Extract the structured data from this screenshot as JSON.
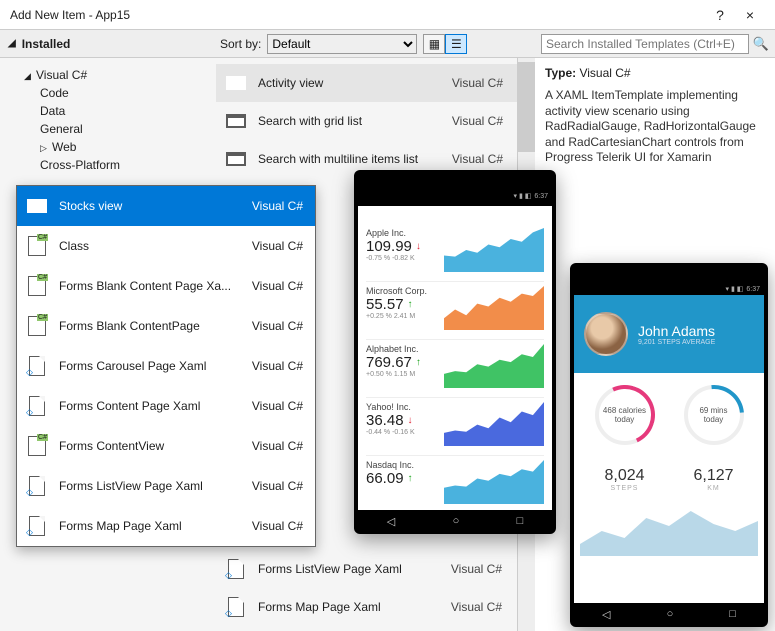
{
  "window": {
    "title": "Add New Item - App15",
    "help": "?",
    "close": "×"
  },
  "header": {
    "installed": "Installed",
    "sort_label": "Sort by:",
    "sort_value": "Default",
    "search_placeholder": "Search Installed Templates (Ctrl+E)"
  },
  "tree": {
    "root": "Visual C#",
    "items": [
      "Code",
      "Data",
      "General",
      "Web",
      "Cross-Platform"
    ]
  },
  "templates_bg": [
    {
      "label": "Activity view",
      "lang": "Visual C#",
      "sel": true,
      "icon": "rect"
    },
    {
      "label": "Search with grid list",
      "lang": "Visual C#",
      "icon": "rect"
    },
    {
      "label": "Search with multiline items list",
      "lang": "Visual C#",
      "icon": "rect"
    }
  ],
  "templates_bg_bottom": [
    {
      "label": "Forms ListView Page Xaml",
      "lang": "Visual C#",
      "icon": "page"
    },
    {
      "label": "Forms Map Page Xaml",
      "lang": "Visual C#",
      "icon": "page"
    }
  ],
  "popup": [
    {
      "label": "Stocks view",
      "lang": "Visual C#",
      "sel": true,
      "icon": "rect"
    },
    {
      "label": "Class",
      "lang": "Visual C#",
      "icon": "cs"
    },
    {
      "label": "Forms Blank Content Page Xa...",
      "lang": "Visual C#",
      "icon": "cs"
    },
    {
      "label": "Forms Blank ContentPage",
      "lang": "Visual C#",
      "icon": "cs"
    },
    {
      "label": "Forms Carousel Page Xaml",
      "lang": "Visual C#",
      "icon": "page"
    },
    {
      "label": "Forms Content Page Xaml",
      "lang": "Visual C#",
      "icon": "page"
    },
    {
      "label": "Forms ContentView",
      "lang": "Visual C#",
      "icon": "cs"
    },
    {
      "label": "Forms ListView Page Xaml",
      "lang": "Visual C#",
      "icon": "page"
    },
    {
      "label": "Forms Map Page Xaml",
      "lang": "Visual C#",
      "icon": "page"
    }
  ],
  "right": {
    "type_label": "Type:",
    "type_value": "Visual C#",
    "description": "A XAML ItemTemplate implementing activity view scenario using RadRadialGauge, RadHorizontalGauge and RadCartesianChart controls from Progress Telerik UI for Xamarin"
  },
  "phone1": {
    "time": "6:37",
    "stocks": [
      {
        "name": "Apple Inc.",
        "price": "109.99",
        "dir": "dn",
        "sub": "-0.75 %    -0.82 K",
        "color": "#2aa5d8"
      },
      {
        "name": "Microsoft Corp.",
        "price": "55.57",
        "dir": "up",
        "sub": "+0.25 %    2.41 M",
        "color": "#f0792a"
      },
      {
        "name": "Alphabet Inc.",
        "price": "769.67",
        "dir": "up",
        "sub": "+0.50 %    1.15 M",
        "color": "#1fb84a"
      },
      {
        "name": "Yahoo! Inc.",
        "price": "36.48",
        "dir": "dn",
        "sub": "-0.44 %    -0.16 K",
        "color": "#2a4fd8"
      },
      {
        "name": "Nasdaq Inc.",
        "price": "66.09",
        "dir": "up",
        "sub": "",
        "color": "#2aa5d8"
      }
    ]
  },
  "phone2": {
    "time": "6:37",
    "name": "John Adams",
    "sub": "9,201 STEPS AVERAGE",
    "gauge1": {
      "val": "468 calories",
      "unit": "today"
    },
    "gauge2": {
      "val": "69 mins",
      "unit": "today"
    },
    "stat1": {
      "num": "8,024",
      "lbl": "STEPS"
    },
    "stat2": {
      "num": "6,127",
      "lbl": "KM"
    }
  },
  "chart_data": [
    {
      "type": "line",
      "title": "Stocks sparklines preview",
      "series": [
        {
          "name": "Apple Inc.",
          "values": [
            30,
            28,
            40,
            35,
            50,
            45,
            60,
            55,
            72,
            80
          ],
          "color": "#2aa5d8"
        },
        {
          "name": "Microsoft Corp.",
          "values": [
            20,
            35,
            25,
            45,
            40,
            55,
            48,
            62,
            58,
            75
          ],
          "color": "#f0792a"
        },
        {
          "name": "Alphabet Inc.",
          "values": [
            25,
            30,
            28,
            42,
            38,
            50,
            46,
            60,
            55,
            78
          ],
          "color": "#1fb84a"
        },
        {
          "name": "Yahoo! Inc.",
          "values": [
            22,
            26,
            24,
            36,
            30,
            48,
            40,
            58,
            52,
            74
          ],
          "color": "#2a4fd8"
        },
        {
          "name": "Nasdaq Inc.",
          "values": [
            28,
            32,
            30,
            44,
            40,
            52,
            48,
            60,
            56,
            76
          ],
          "color": "#2aa5d8"
        }
      ],
      "xlabel": "",
      "ylabel": "",
      "ylim": [
        0,
        100
      ]
    },
    {
      "type": "area",
      "title": "Activity steps area",
      "values": [
        20,
        35,
        28,
        50,
        42,
        60,
        48,
        40
      ],
      "color": "#9fc9dd",
      "ylim": [
        0,
        100
      ]
    }
  ]
}
